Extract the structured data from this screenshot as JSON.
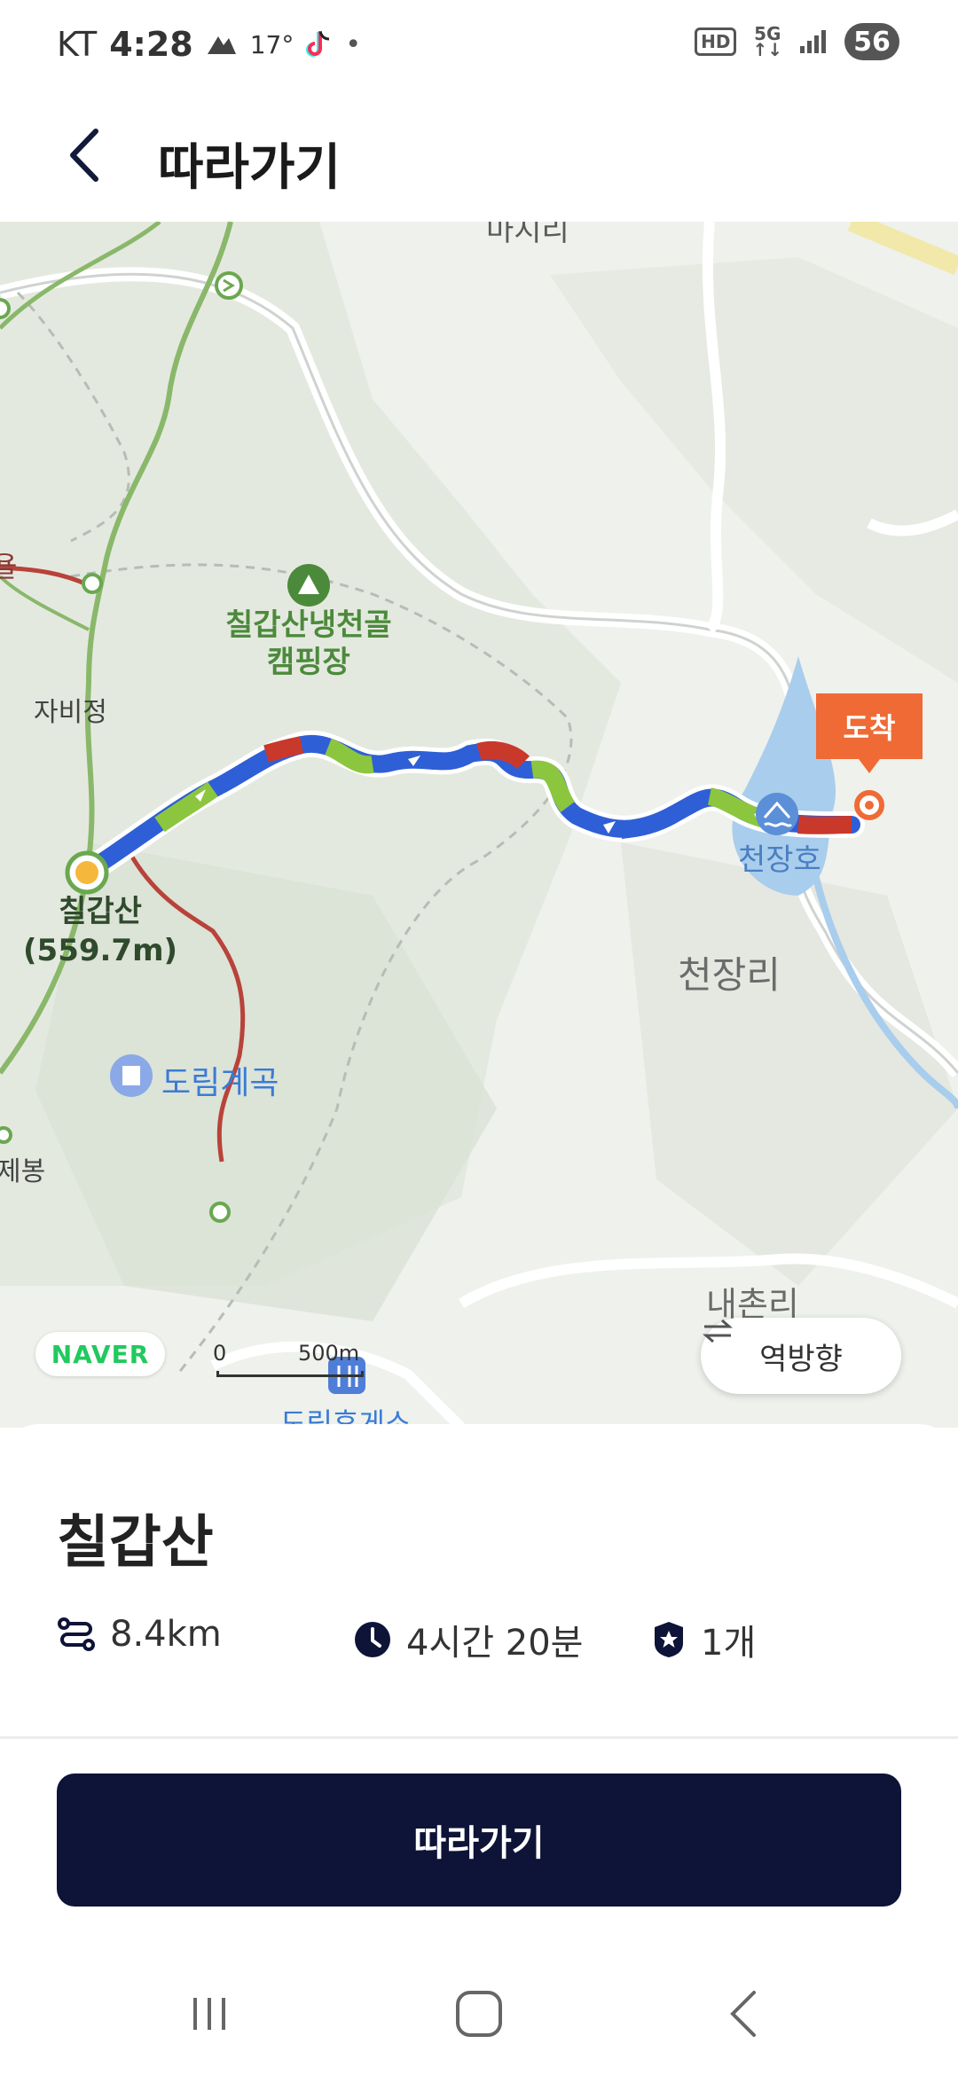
{
  "status_bar": {
    "carrier": "KT",
    "time": "4:28",
    "temperature": "17°",
    "battery": "56"
  },
  "header": {
    "title": "따라가기",
    "back_icon": "chevron-left-icon"
  },
  "map": {
    "labels": {
      "top_village": "마지리",
      "camp": "칠갑산냉천골\n캠핑장",
      "pavilion": "자비정",
      "peak_name": "칠갑산",
      "peak_height": "(559.7m)",
      "valley": "도림계곡",
      "reservoir": "천장호",
      "village_mid": "천장리",
      "village_low": "내촌리",
      "rest_area": "도림휴게소",
      "left_peak": "제봉",
      "trail_stub": "욜"
    },
    "naver_logo": "NAVER",
    "scale": {
      "zero": "0",
      "distance": "500m"
    },
    "arrive_marker": "도착",
    "reverse_button": "역방향",
    "route_color_start": "#f5b83d",
    "colors": {
      "route_blue": "#2f5fd6",
      "route_green": "#8cc63f",
      "route_red": "#c9392b",
      "trail_green": "#8ab86a",
      "trail_red": "#b8433a",
      "accent_orange": "#f06a35"
    }
  },
  "sheet": {
    "trail_name": "칠갑산",
    "distance": "8.4km",
    "duration": "4시간 20분",
    "stamps": "1개",
    "follow_button": "따라가기",
    "button_color": "#0e1338"
  },
  "nav": {
    "recent": "recents-icon",
    "home": "home-icon",
    "back": "back-icon"
  }
}
